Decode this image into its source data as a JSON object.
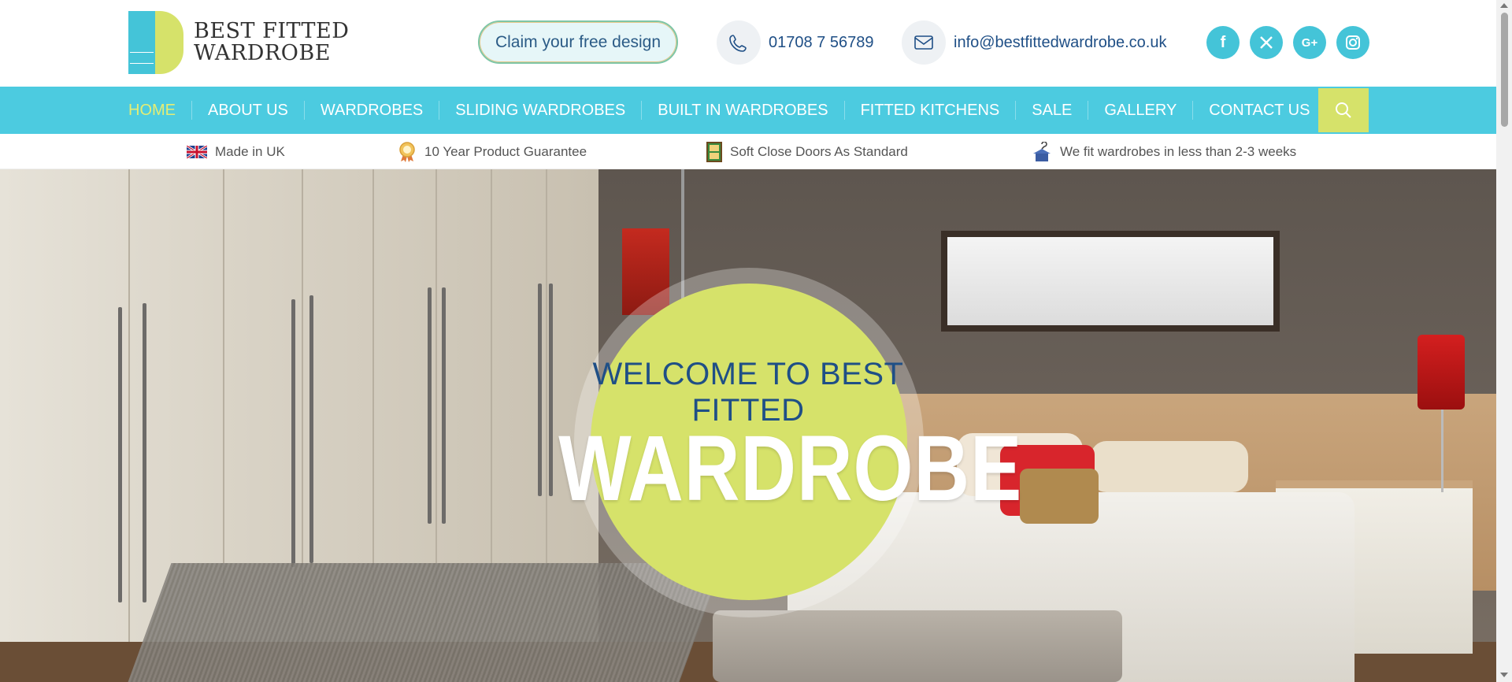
{
  "header": {
    "logo_line1": "BEST FITTED",
    "logo_line2": "WARDROBE",
    "claim_button": "Claim your free design",
    "phone": "01708 7 56789",
    "email": "info@bestfittedwardrobe.co.uk",
    "social": [
      {
        "name": "facebook",
        "glyph": "f"
      },
      {
        "name": "x",
        "glyph": "X"
      },
      {
        "name": "google-plus",
        "glyph": "G+"
      },
      {
        "name": "instagram",
        "glyph": ""
      }
    ]
  },
  "nav": {
    "items": [
      "HOME",
      "ABOUT US",
      "WARDROBES",
      "SLIDING WARDROBES",
      "BUILT IN WARDROBES",
      "FITTED KITCHENS",
      "SALE",
      "GALLERY",
      "CONTACT US"
    ],
    "active": "HOME"
  },
  "features": [
    {
      "icon": "uk-flag-icon",
      "label": "Made in UK"
    },
    {
      "icon": "award-ribbon-icon",
      "label": "10 Year Product Guarantee"
    },
    {
      "icon": "door-icon",
      "label": "Soft Close Doors As Standard"
    },
    {
      "icon": "hanger-icon",
      "label": "We fit wardrobes in less than 2-3 weeks"
    }
  ],
  "hero": {
    "welcome_line1": "WELCOME TO BEST",
    "welcome_line2": "FITTED",
    "brand": "WARDROBE"
  },
  "colors": {
    "accent_blue": "#4ccbe0",
    "accent_yellow": "#d6e26a",
    "navy_text": "#1f4f86"
  }
}
